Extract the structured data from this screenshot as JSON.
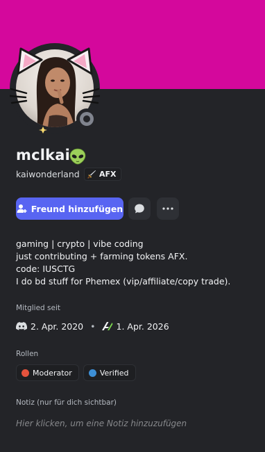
{
  "profile": {
    "display_name": "mclkai",
    "display_name_emoji": "alien-emoji",
    "username": "kaiwonderland",
    "server_tag": "AFX",
    "banner_color": "#d4089c",
    "status": "offline"
  },
  "actions": {
    "add_friend_label": "Freund hinzufügen",
    "message_icon": "chat-bubble-icon",
    "more_icon": "more-icon"
  },
  "bio": [
    "gaming | crypto | vibe coding",
    "just contributing + farming tokens AFX.",
    "code: IUSCTG",
    "I do bd stuff for Phemex (vip/affiliate/copy trade)."
  ],
  "member_since": {
    "title": "Mitglied seit",
    "discord_date": "2. Apr. 2020",
    "server_date": "1. Apr. 2026"
  },
  "roles": {
    "title": "Rollen",
    "items": [
      {
        "name": "Moderator",
        "color": "#e5533d"
      },
      {
        "name": "Verified",
        "color": "#3d8fd6"
      }
    ]
  },
  "note": {
    "title": "Notiz (nur für dich sichtbar)",
    "placeholder": "Hier klicken, um eine Notiz hinzuzufügen"
  },
  "colors": {
    "accent": "#5865f2",
    "background": "#232428"
  }
}
